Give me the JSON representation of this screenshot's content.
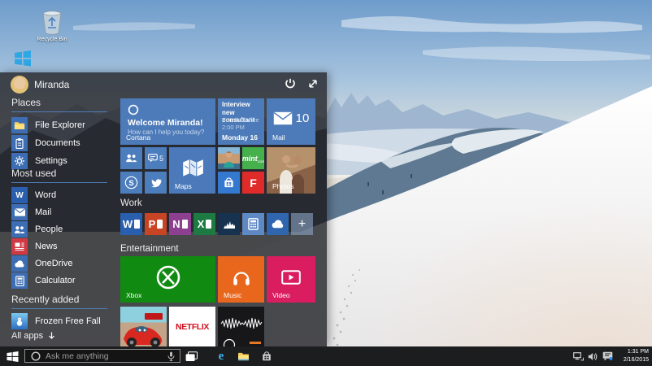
{
  "desktop": {
    "recycle_bin": {
      "label": "Recycle Bin"
    }
  },
  "start_menu": {
    "user": {
      "name": "Miranda"
    },
    "places": {
      "title": "Places",
      "items": [
        {
          "label": "File Explorer",
          "icon": "folder-icon"
        },
        {
          "label": "Documents",
          "icon": "document-icon"
        },
        {
          "label": "Settings",
          "icon": "gear-icon"
        }
      ]
    },
    "most_used": {
      "title": "Most used",
      "items": [
        {
          "label": "Word",
          "icon": "word-icon"
        },
        {
          "label": "Mail",
          "icon": "envelope-icon"
        },
        {
          "label": "People",
          "icon": "people-icon"
        },
        {
          "label": "News",
          "icon": "news-icon"
        },
        {
          "label": "OneDrive",
          "icon": "cloud-icon"
        },
        {
          "label": "Calculator",
          "icon": "calculator-icon"
        }
      ]
    },
    "recently_added": {
      "title": "Recently added",
      "items": [
        {
          "label": "Frozen Free Fall",
          "icon": "frozen-icon"
        }
      ]
    },
    "all_apps": {
      "label": "All apps"
    },
    "groups": {
      "work": "Work",
      "entertainment": "Entertainment"
    },
    "tiles": {
      "cortana": {
        "title": "Welcome Miranda!",
        "subtitle": "How can I help you today?",
        "label": "Cortana"
      },
      "calendar": {
        "event": "Interview new consultant",
        "location": "Fourth Coffee",
        "time": "2:00 PM",
        "label": "Monday 16"
      },
      "mail": {
        "count": "10",
        "label": "Mail"
      },
      "messaging": {
        "count": "5"
      },
      "maps": {
        "label": "Maps"
      },
      "mint": {
        "label": "mint",
        "suffix": "com"
      },
      "photos": {
        "label": "Photos"
      },
      "xbox": {
        "label": "Xbox"
      },
      "music": {
        "label": "Music"
      },
      "video": {
        "label": "Video"
      },
      "netflix": {
        "label": "NETFLIX"
      }
    }
  },
  "taskbar": {
    "search": {
      "placeholder": "Ask me anything"
    },
    "clock": {
      "time": "1:31 PM",
      "date": "2/16/2015"
    }
  },
  "colors": {
    "accent_blue": "#4f7cba",
    "tile_blue": "#4d7ab8",
    "xbox_green": "#118a11",
    "music_orange": "#e8671d",
    "video_magenta": "#d91d5e",
    "word_blue": "#2a5fad",
    "powerpoint_red": "#c74425",
    "onenote_purple": "#8d3f90",
    "excel_green": "#1e7a43",
    "money_navy": "#16324f",
    "onedrive_blue": "#2f66ad",
    "news_red": "#cf3a44",
    "flipboard_red": "#e12b2b",
    "mint_green": "#46b14c",
    "store_blue": "#3578d0",
    "netflix_red": "#d30f1e",
    "taskbar_bg": "#1c1d1f"
  }
}
